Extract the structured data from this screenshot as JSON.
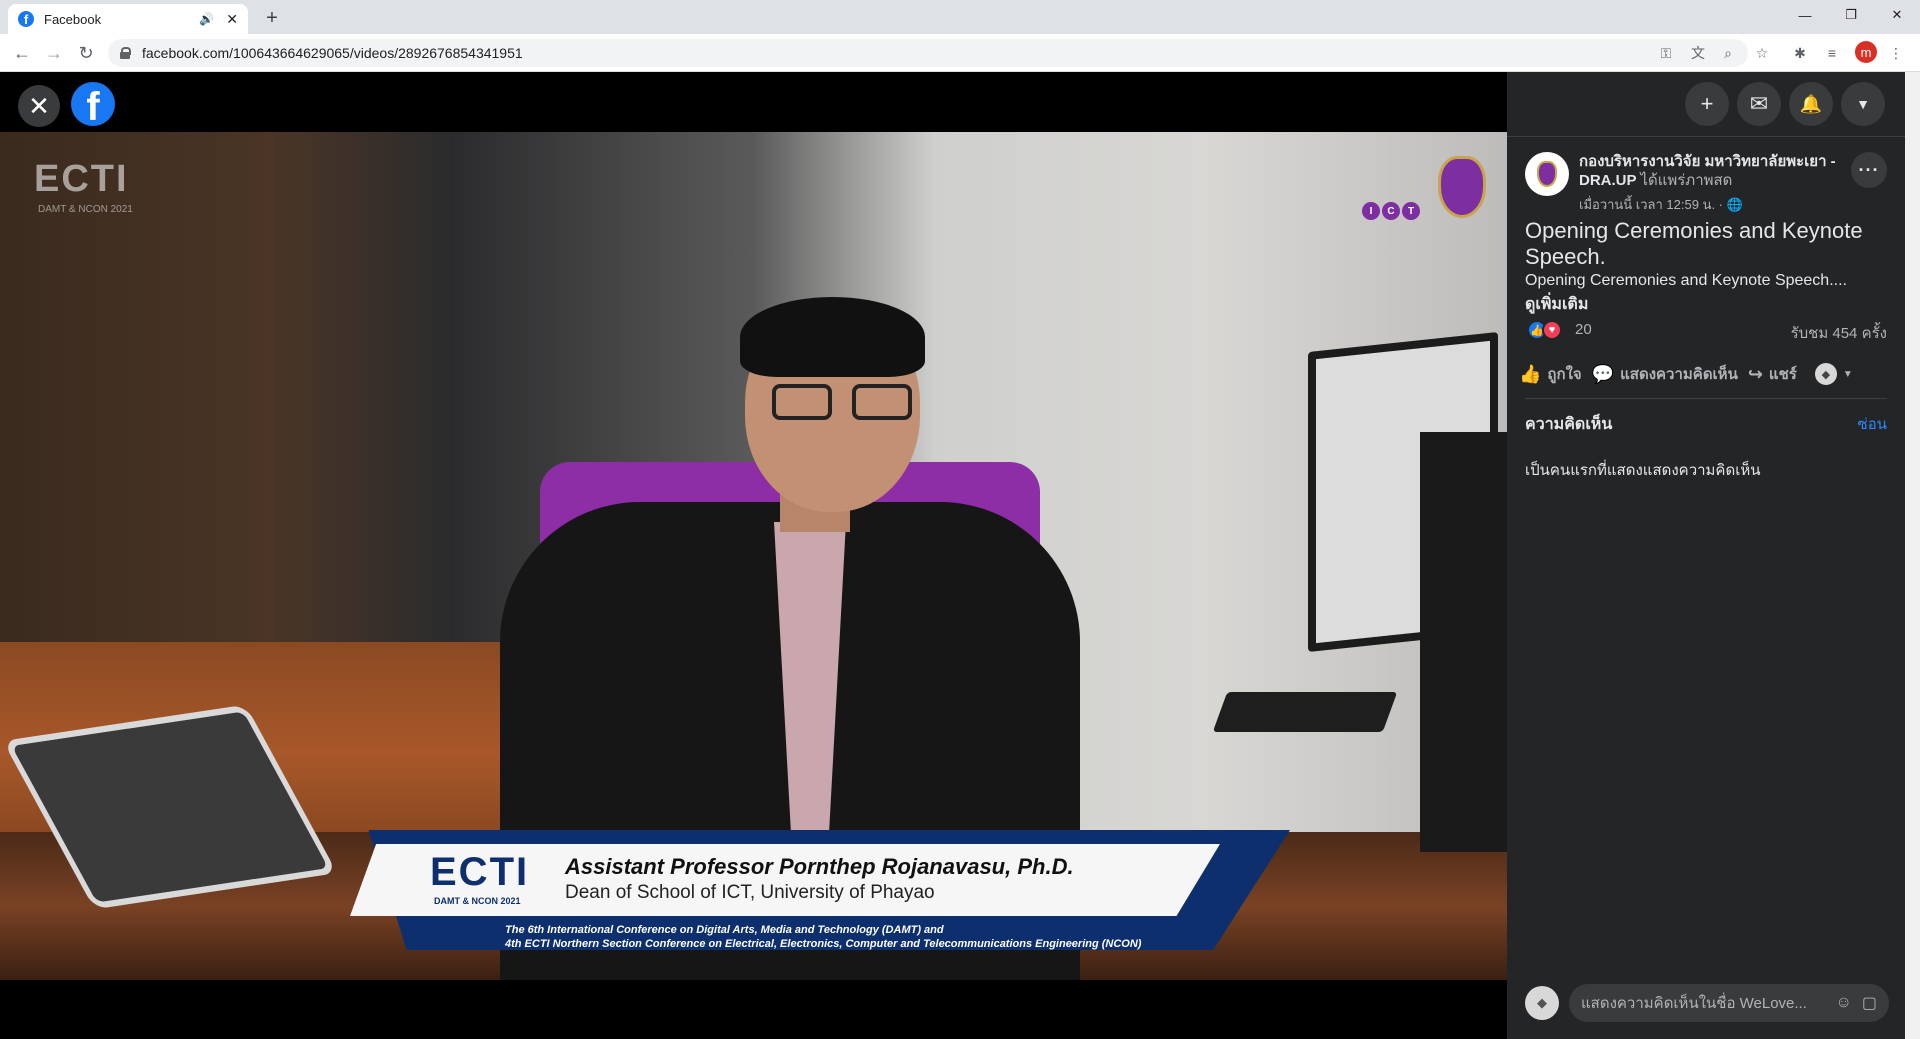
{
  "browser": {
    "tab_title": "Facebook",
    "tab_favicon": "f",
    "new_tab": "+",
    "url": "facebook.com/100643664629065/videos/2892676854341951",
    "profile_initial": "m",
    "window_minimize": "—",
    "window_restore": "❐",
    "window_close": "✕"
  },
  "viewer": {
    "close_icon": "✕",
    "logo_letter": "f"
  },
  "video": {
    "corner_logo": "ECTI",
    "corner_logo_sub": "DAMT & NCON 2021",
    "ict_logo_letters": [
      "I",
      "C",
      "T"
    ],
    "lower_third": {
      "logo": "ECTI",
      "logo_sub": "DAMT & NCON 2021",
      "name": "Assistant Professor Pornthep Rojanavasu, Ph.D.",
      "role": "Dean of School of ICT, University of Phayao",
      "conference_line1": "The 6th International Conference on Digital Arts, Media and Technology (DAMT) and",
      "conference_line2": "4th ECTI Northern Section Conference on Electrical, Electronics, Computer and Telecommunications Engineering (NCON)"
    }
  },
  "panel": {
    "top_buttons": {
      "create": "+",
      "messenger": "✉",
      "notifications": "🔔",
      "account": "▼"
    },
    "page_name": "กองบริหารงานวิจัย มหาวิทยาลัยพะเยา - DRA.UP",
    "page_action": "ได้แพร่ภาพสด",
    "post_time": "เมื่อวานนี้ เวลา 12:59 น. · 🌐",
    "more": "···",
    "title": "Opening Ceremonies and Keynote Speech.",
    "description": "Opening Ceremonies and Keynote Speech....",
    "see_more": "ดูเพิ่มเติม",
    "reaction_count": "20",
    "views": "รับชม 454 ครั้ง",
    "actions": {
      "like": "ถูกใจ",
      "comment": "แสดงความคิดเห็น",
      "share": "แชร์"
    },
    "comments_heading": "ความคิดเห็น",
    "hide": "ซ่อน",
    "first_comment_prompt": "เป็นคนแรกที่แสดงแสดงความคิดเห็น",
    "composer_placeholder": "แสดงความคิดเห็นในชื่อ WeLove..."
  },
  "colors": {
    "facebook_blue": "#1877f2",
    "panel_bg": "#242526",
    "love_red": "#f33e58",
    "lower_third_navy": "#0e2f6e",
    "link_blue": "#2d88ff"
  }
}
